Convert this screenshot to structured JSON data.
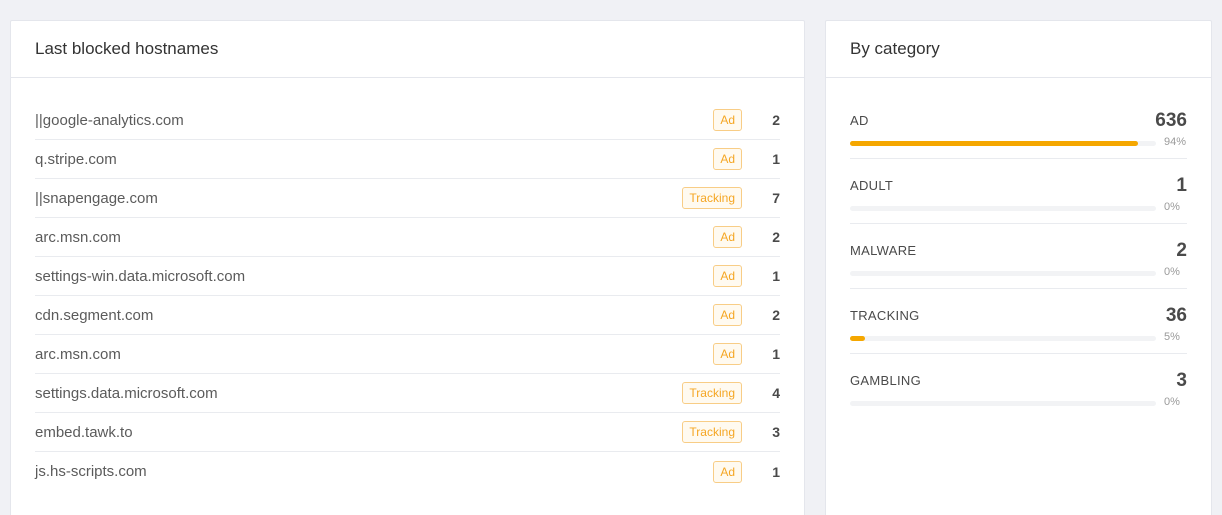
{
  "hostnames_card": {
    "title": "Last blocked hostnames",
    "rows": [
      {
        "host": "||google-analytics.com",
        "tag": "Ad",
        "count": "2"
      },
      {
        "host": "q.stripe.com",
        "tag": "Ad",
        "count": "1"
      },
      {
        "host": "||snapengage.com",
        "tag": "Tracking",
        "count": "7"
      },
      {
        "host": "arc.msn.com",
        "tag": "Ad",
        "count": "2"
      },
      {
        "host": "settings-win.data.microsoft.com",
        "tag": "Ad",
        "count": "1"
      },
      {
        "host": "cdn.segment.com",
        "tag": "Ad",
        "count": "2"
      },
      {
        "host": "arc.msn.com",
        "tag": "Ad",
        "count": "1"
      },
      {
        "host": "settings.data.microsoft.com",
        "tag": "Tracking",
        "count": "4"
      },
      {
        "host": "embed.tawk.to",
        "tag": "Tracking",
        "count": "3"
      },
      {
        "host": "js.hs-scripts.com",
        "tag": "Ad",
        "count": "1"
      }
    ]
  },
  "category_card": {
    "title": "By category",
    "categories": [
      {
        "name": "AD",
        "count": "636",
        "percent": 94,
        "percent_label": "94%"
      },
      {
        "name": "ADULT",
        "count": "1",
        "percent": 0,
        "percent_label": "0%"
      },
      {
        "name": "MALWARE",
        "count": "2",
        "percent": 0,
        "percent_label": "0%"
      },
      {
        "name": "TRACKING",
        "count": "36",
        "percent": 5,
        "percent_label": "5%"
      },
      {
        "name": "GAMBLING",
        "count": "3",
        "percent": 0,
        "percent_label": "0%"
      }
    ]
  },
  "colors": {
    "accent": "#f5a700",
    "tag_text": "#f5a623",
    "tag_border": "#f8cd86"
  }
}
